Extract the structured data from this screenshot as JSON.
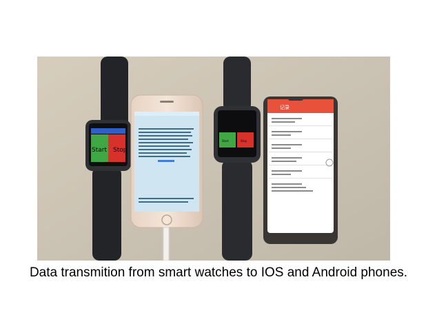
{
  "caption": "Data transmition from smart watches to IOS and Android phones.",
  "watch1": {
    "start_label": "Start",
    "stop_label": "Stop"
  },
  "watch2": {
    "start_label": "Start",
    "stop_label": "Stop"
  },
  "android": {
    "header_title": "记录"
  },
  "colors": {
    "tabletop": "#cfc6b6",
    "watch_body": "#2a2b2e",
    "green_button": "#3fa845",
    "red_button": "#d7312b",
    "android_header": "#e8513a"
  }
}
